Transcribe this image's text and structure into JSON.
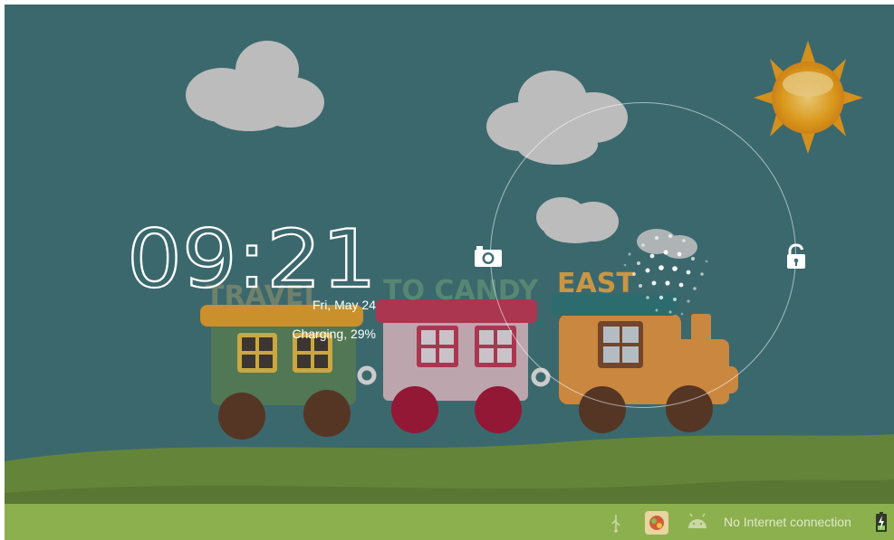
{
  "lockscreen": {
    "time": "09:21",
    "date": "Fri, May 24",
    "charging": "Charging, 29%",
    "wallpaper_text": [
      "TRAVEL",
      "TO CANDY",
      "EAST"
    ]
  },
  "status_bar": {
    "network_text": "No Internet connection",
    "icons": [
      "usb-icon",
      "app-notification-icon",
      "android-debug-icon",
      "battery-charging-icon"
    ]
  },
  "colors": {
    "sky": "#3f6f74",
    "grass": "#6b8d3e",
    "status_bar": "#8db04e",
    "sun": "#e8a21e"
  }
}
